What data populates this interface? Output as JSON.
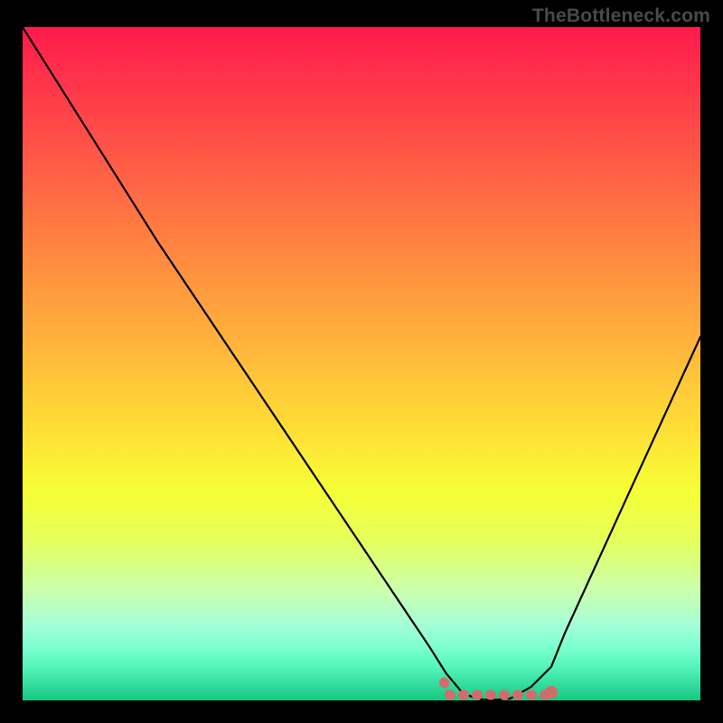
{
  "watermark": "TheBottleneck.com",
  "chart_data": {
    "type": "line",
    "title": "",
    "xlabel": "",
    "ylabel": "",
    "xlim": [
      0,
      100
    ],
    "ylim": [
      0,
      100
    ],
    "x": [
      0,
      5,
      10,
      15,
      20,
      25,
      30,
      35,
      40,
      45,
      50,
      55,
      60,
      62.5,
      65,
      67,
      68,
      70,
      72,
      75,
      78,
      80,
      85,
      90,
      95,
      100
    ],
    "values": [
      100,
      92,
      84,
      76,
      68,
      60.5,
      53,
      45.5,
      38,
      30.5,
      23,
      15.5,
      8,
      4,
      1,
      0.3,
      0.1,
      0.1,
      0.3,
      2,
      5,
      10,
      21,
      32,
      43,
      54
    ],
    "series": [
      {
        "name": "bottleneck-curve",
        "color": "#000000"
      }
    ],
    "marker": {
      "x_range": [
        63,
        78
      ],
      "color": "#d46a6a",
      "style": "dotted-band"
    },
    "gradient_stops": [
      {
        "pos": 0,
        "color": "#ff1a4d"
      },
      {
        "pos": 50,
        "color": "#ffdf36"
      },
      {
        "pos": 76,
        "color": "#e6ff5a"
      },
      {
        "pos": 100,
        "color": "#16c97e"
      }
    ]
  }
}
